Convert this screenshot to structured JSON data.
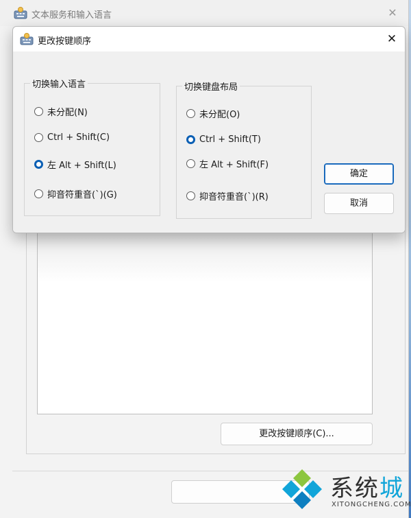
{
  "outer_window": {
    "title": "文本服务和输入语言",
    "change_sequence_button": "更改按键顺序(C)..."
  },
  "dialog": {
    "title": "更改按键顺序",
    "input_language_group": {
      "label": "切换输入语言",
      "options": [
        {
          "label": "未分配(N)",
          "checked": false
        },
        {
          "label": "Ctrl + Shift(C)",
          "checked": false
        },
        {
          "label": "左 Alt + Shift(L)",
          "checked": true
        },
        {
          "label": "抑音符重音(`)(G)",
          "checked": false
        }
      ]
    },
    "keyboard_layout_group": {
      "label": "切换键盘布局",
      "options": [
        {
          "label": "未分配(O)",
          "checked": false
        },
        {
          "label": "Ctrl + Shift(T)",
          "checked": true
        },
        {
          "label": "左 Alt + Shift(F)",
          "checked": false
        },
        {
          "label": "抑音符重音(`)(R)",
          "checked": false
        }
      ]
    },
    "ok_label": "确定",
    "cancel_label": "取消"
  },
  "watermark": {
    "brand_main": "系统",
    "brand_accent": "城",
    "domain": "XITONGCHENG.COM"
  },
  "colors": {
    "accent": "#0a5fb4",
    "watermark_cyan": "#11a5d9"
  }
}
